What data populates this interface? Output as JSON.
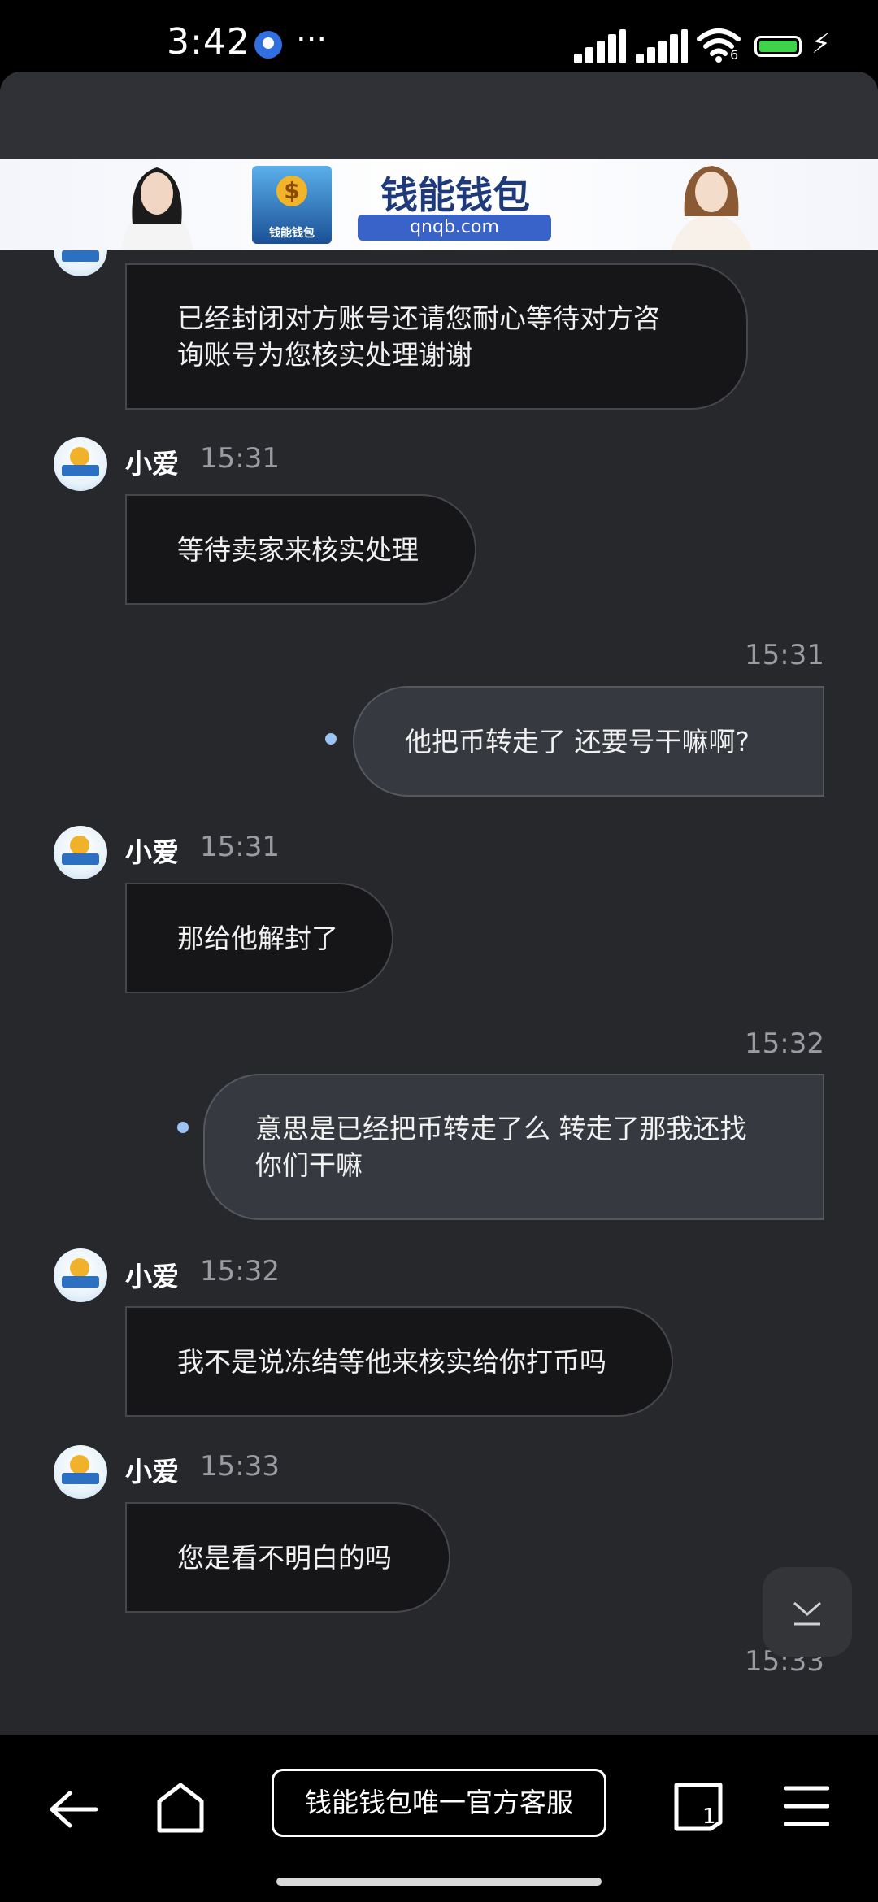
{
  "status_bar": {
    "time": "3:42",
    "dots": "···",
    "wifi_badge": "6"
  },
  "banner": {
    "brand": "钱能钱包",
    "url": "qnqb.com",
    "logo_text": "钱能钱包"
  },
  "chat": {
    "messages": [
      {
        "dir": "in",
        "text_lines": [
          "已经封闭对方账号还请您耐心等待对方咨",
          "询账号为您核实处理谢谢"
        ]
      },
      {
        "dir": "in",
        "sender": "小爱",
        "time": "15:31",
        "text_lines": [
          "等待卖家来核实处理"
        ]
      },
      {
        "dir": "out",
        "time": "15:31",
        "text_lines": [
          "他把币转走了 还要号干嘛啊?"
        ]
      },
      {
        "dir": "in",
        "sender": "小爱",
        "time": "15:31",
        "text_lines": [
          "那给他解封了"
        ]
      },
      {
        "dir": "out",
        "time": "15:32",
        "text_lines": [
          "意思是已经把币转走了么 转走了那我还找",
          "你们干嘛"
        ]
      },
      {
        "dir": "in",
        "sender": "小爱",
        "time": "15:32",
        "text_lines": [
          "我不是说冻结等他来核实给你打币吗"
        ]
      },
      {
        "dir": "in",
        "sender": "小爱",
        "time": "15:33",
        "text_lines": [
          "您是看不明白的吗"
        ]
      },
      {
        "dir": "out",
        "time": "15:33",
        "text_lines": []
      }
    ]
  },
  "bottom_nav": {
    "center_label": "钱能钱包唯一官方客服",
    "tab_count": "1"
  },
  "colors": {
    "chat_bg": "#27282c",
    "bubble_in": "#161618",
    "bubble_out": "#363a40",
    "accent_dot": "#9dc3f2"
  }
}
